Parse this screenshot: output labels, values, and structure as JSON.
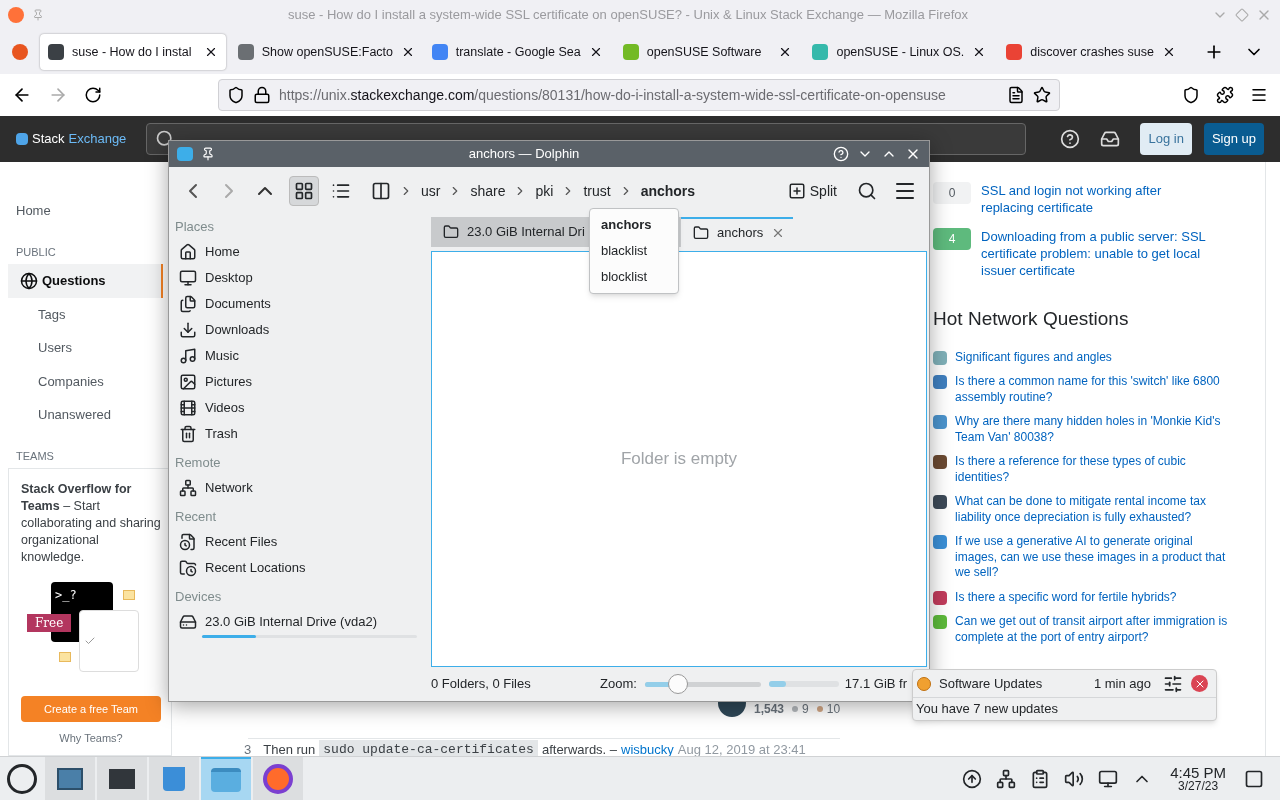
{
  "browser": {
    "window_title": "suse - How do I install a system-wide SSL certificate on openSUSE? - Unix & Linux Stack Exchange — Mozilla Firefox",
    "tabs": [
      {
        "label": "suse - How do I instal",
        "selected": true,
        "color": "#3b4045"
      },
      {
        "label": "Show openSUSE:Facto",
        "selected": false,
        "color": "#6b6f73"
      },
      {
        "label": "translate - Google Sea",
        "selected": false,
        "color": "#4285f4"
      },
      {
        "label": "openSUSE Software",
        "selected": false,
        "color": "#73ba25"
      },
      {
        "label": "openSUSE - Linux OS.",
        "selected": false,
        "color": "#35b9ab"
      },
      {
        "label": "discover crashes suse",
        "selected": false,
        "color": "#ea4335"
      }
    ],
    "url": {
      "scheme": "https://unix.",
      "host": "stackexchange.com",
      "path": "/questions/80131/how-do-i-install-a-system-wide-ssl-certificate-on-opensuse"
    }
  },
  "site_header": {
    "logo_start": "Stack",
    "logo_end": "Exchange",
    "login": "Log in",
    "signup": "Sign up"
  },
  "sidebar": {
    "items": [
      {
        "kind": "link",
        "label": "Home",
        "selected": false
      },
      {
        "kind": "heading",
        "label": "PUBLIC"
      },
      {
        "kind": "link",
        "label": "Questions",
        "selected": true
      },
      {
        "kind": "link",
        "label": "Tags",
        "selected": false
      },
      {
        "kind": "link",
        "label": "Users",
        "selected": false
      },
      {
        "kind": "link",
        "label": "Companies",
        "selected": false
      },
      {
        "kind": "link",
        "label": "Unanswered",
        "selected": false
      },
      {
        "kind": "heading",
        "label": "TEAMS"
      }
    ]
  },
  "teams_promo": {
    "text": "**Stack Overflow for Teams** – Start collaborating and sharing organizational knowledge.",
    "prompt": ">_?",
    "badge": "Free",
    "button": "Create a free Team",
    "link": "Why Teams?"
  },
  "user_card": {
    "reputation": "1,543",
    "silver": "9",
    "bronze": "10"
  },
  "comment": {
    "number": "3",
    "before": "Then run",
    "code": "sudo update-ca-certificates",
    "after": "afterwards. –",
    "user": "wisbucky",
    "date": "Aug 12, 2019 at 23:41"
  },
  "related": [
    {
      "votes": "0",
      "answered": false,
      "title": "SSL and login not working after replacing certificate"
    },
    {
      "votes": "4",
      "answered": true,
      "title": "Downloading from a public server: SSL certificate problem: unable to get local issuer certificate"
    }
  ],
  "hot_network": {
    "title": "Hot Network Questions",
    "items": [
      {
        "title": "Significant figures and angles",
        "color": "#7fb0b8"
      },
      {
        "title": "Is there a common name for this 'switch' like 6800 assembly routine?",
        "color": "#3f7fbf"
      },
      {
        "title": "Why are there many hidden holes in 'Monkie Kid's Team Van' 80038?",
        "color": "#4b93cc"
      },
      {
        "title": "Is there a reference for these types of cubic identities?",
        "color": "#6b4a32"
      },
      {
        "title": "What can be done to mitigate rental income tax liability once depreciation is fully exhausted?",
        "color": "#3d4a58"
      },
      {
        "title": "If we use a generative AI to generate original images, can we use these images in a product that we sell?",
        "color": "#3b8fd6"
      },
      {
        "title": "Is there a specific word for fertile hybrids?",
        "color": "#c23c5c"
      },
      {
        "title": "Can we get out of transit airport after immigration is complete at the port of entry airport?",
        "color": "#5dba3b"
      }
    ]
  },
  "dolphin": {
    "title": "anchors — Dolphin",
    "breadcrumb": [
      "usr",
      "share",
      "pki",
      "trust",
      "anchors"
    ],
    "split": "Split",
    "places": [
      {
        "title": "Places",
        "items": [
          {
            "label": "Home"
          },
          {
            "label": "Desktop"
          },
          {
            "label": "Documents"
          },
          {
            "label": "Downloads"
          },
          {
            "label": "Music"
          },
          {
            "label": "Pictures"
          },
          {
            "label": "Videos"
          },
          {
            "label": "Trash"
          }
        ]
      },
      {
        "title": "Remote",
        "items": [
          {
            "label": "Network"
          }
        ]
      },
      {
        "title": "Recent",
        "items": [
          {
            "label": "Recent Files"
          },
          {
            "label": "Recent Locations"
          }
        ]
      },
      {
        "title": "Devices",
        "items": [
          {
            "label": "23.0 GiB Internal Drive (vda2)",
            "level": 0.25
          }
        ]
      }
    ],
    "tabs": [
      {
        "label": "23.0 GiB Internal Dri",
        "selected": false
      },
      {
        "label": "anchors",
        "selected": true
      }
    ],
    "empty": "Folder is empty",
    "status": "0 Folders, 0 Files",
    "zoom_label": "Zoom:",
    "zoom": {
      "level": 0.29
    },
    "free_space": {
      "level": 0.25
    },
    "free_text": "17.1 GiB fr",
    "dropdown": [
      {
        "label": "anchors",
        "selected": true
      },
      {
        "label": "blacklist",
        "selected": false
      },
      {
        "label": "blocklist",
        "selected": false
      }
    ]
  },
  "notification": {
    "title": "Software Updates",
    "time": "1 min ago",
    "body": "You have 7 new updates"
  },
  "taskbar": {
    "tasks": [
      {
        "selected": false
      },
      {
        "selected": false
      },
      {
        "selected": false
      },
      {
        "selected": true
      },
      {
        "selected": false
      }
    ],
    "time": "4:45 PM",
    "date": "3/27/23"
  }
}
